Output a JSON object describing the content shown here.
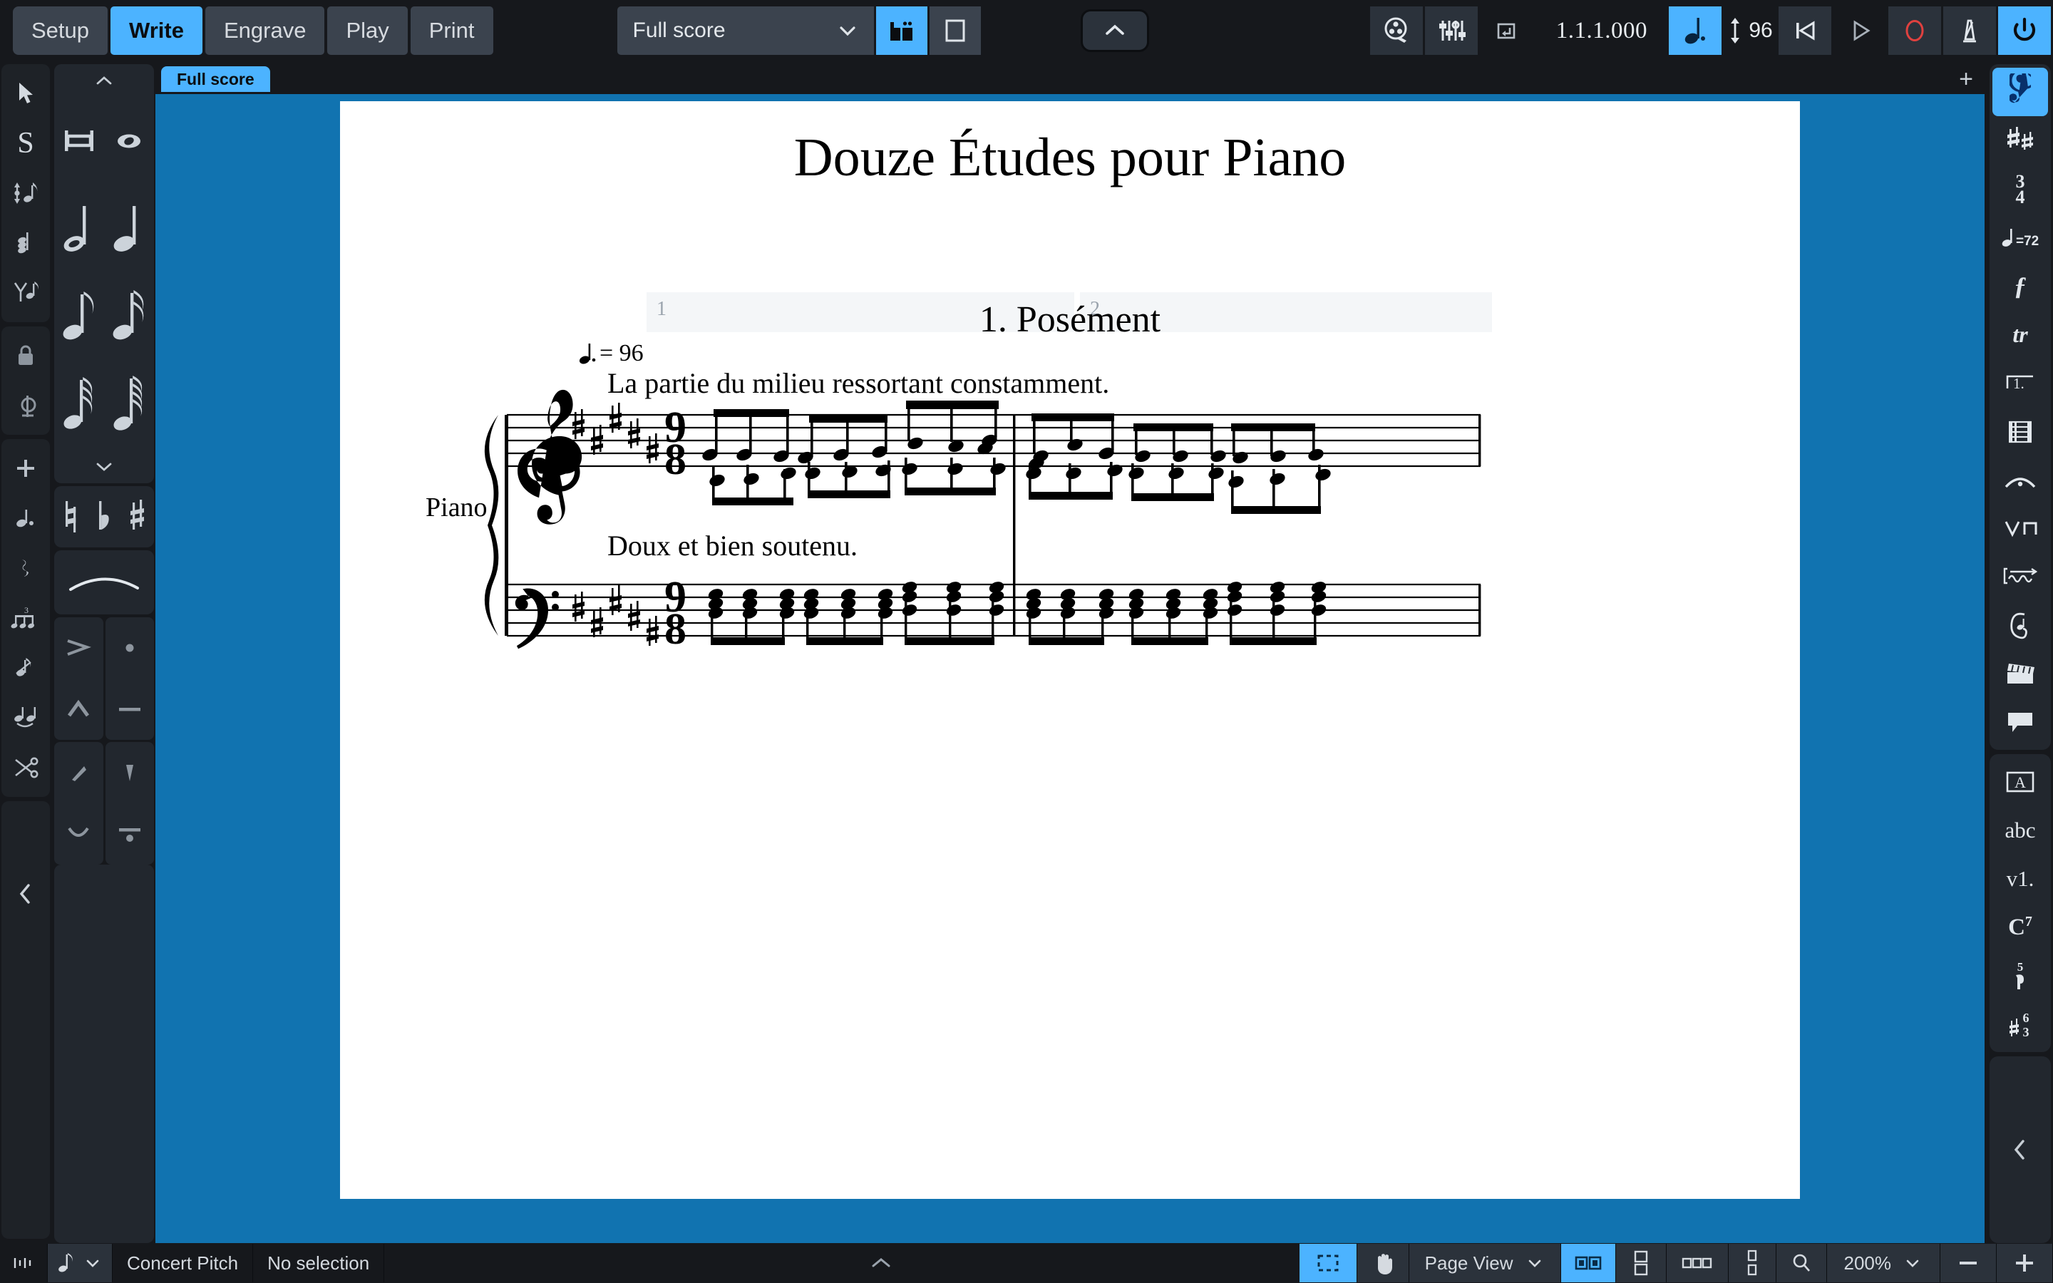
{
  "app": {
    "name": "Dorico",
    "accent": "#4cb3ff",
    "panel_bg": "#22272e",
    "score_bg": "#1173b0"
  },
  "toolbar": {
    "modes": [
      {
        "label": "Setup",
        "active": false,
        "name": "mode-setup"
      },
      {
        "label": "Write",
        "active": true,
        "name": "mode-write"
      },
      {
        "label": "Engrave",
        "active": false,
        "name": "mode-engrave"
      },
      {
        "label": "Play",
        "active": false,
        "name": "mode-play"
      },
      {
        "label": "Print",
        "active": false,
        "name": "mode-print"
      }
    ],
    "layout_select": {
      "value": "Full score",
      "chevron": "chevron-down-icon"
    },
    "view_buttons": [
      {
        "icon": "galley-view-icon",
        "active": true
      },
      {
        "icon": "page-view-icon",
        "active": false
      }
    ],
    "collapse_toolbar": "chevron-up-icon",
    "right_tools": [
      {
        "icon": "video-reel-icon",
        "active": false
      },
      {
        "icon": "mixer-icon",
        "active": false
      },
      {
        "icon": "transport-window-icon",
        "active": false
      }
    ],
    "position_readout": "1.1.1.000",
    "tempo_note_icon": "dotted-quarter-note-icon",
    "tempo_note_active": true,
    "tempo_value": "96",
    "tempo_arrows_icon": "up-down-arrow-icon",
    "transport": [
      {
        "icon": "rewind-to-start-icon",
        "active": false
      },
      {
        "icon": "play-icon",
        "active": false
      },
      {
        "icon": "record-icon",
        "active": false,
        "color": "#e0413f"
      },
      {
        "icon": "metronome-icon",
        "active": false
      },
      {
        "icon": "power-icon",
        "active": true
      }
    ]
  },
  "left_rail": {
    "groups": [
      {
        "items": [
          {
            "icon": "arrow-select-icon",
            "label": "Select tool"
          },
          {
            "icon": "s-slash-icon",
            "label": "Note input"
          },
          {
            "icon": "pitch-before-duration-icon",
            "label": "Pitch before duration"
          },
          {
            "icon": "chord-mode-icon",
            "label": "Chord mode"
          },
          {
            "icon": "voice-icon",
            "label": "Voice"
          }
        ]
      },
      {
        "items": [
          {
            "icon": "lock-duration-icon",
            "label": "Lock duration"
          },
          {
            "icon": "lock-pitch-icon",
            "label": "Lock pitch"
          }
        ]
      },
      {
        "items": [
          {
            "icon": "plus-icon",
            "label": "Insert"
          },
          {
            "icon": "dotted-note-icon",
            "label": "Rhythmic dot"
          },
          {
            "icon": "rest-icon",
            "label": "Rest"
          },
          {
            "icon": "tuplet-icon",
            "label": "Tuplet"
          },
          {
            "icon": "grace-note-icon",
            "label": "Grace note"
          },
          {
            "icon": "tie-icon",
            "label": "Tie"
          },
          {
            "icon": "scissors-icon",
            "label": "Cut"
          }
        ]
      }
    ],
    "collapse": "chevron-left-icon"
  },
  "notes_panel": {
    "scroll_up": "chevron-up-icon",
    "scroll_down": "chevron-down-icon",
    "durations": [
      {
        "icon": "breve-icon",
        "label": "Breve"
      },
      {
        "icon": "whole-note-icon",
        "label": "Whole note"
      },
      {
        "icon": "half-note-icon",
        "label": "Half note"
      },
      {
        "icon": "quarter-note-icon",
        "label": "Quarter note"
      },
      {
        "icon": "eighth-note-icon",
        "label": "Eighth note"
      },
      {
        "icon": "sixteenth-note-icon",
        "label": "16th note"
      },
      {
        "icon": "thirtysecond-note-icon",
        "label": "32nd note"
      },
      {
        "icon": "sixtyfourth-note-icon",
        "label": "64th note"
      }
    ],
    "accidentals": [
      {
        "icon": "natural-icon",
        "label": "Natural"
      },
      {
        "icon": "flat-icon",
        "label": "Flat"
      },
      {
        "icon": "sharp-icon",
        "label": "Sharp"
      }
    ],
    "slur": {
      "icon": "slur-icon",
      "label": "Slur"
    },
    "articulations": [
      {
        "icon": "accent-icon",
        "label": "Accent"
      },
      {
        "icon": "staccato-icon",
        "label": "Staccato"
      },
      {
        "icon": "marcato-icon",
        "label": "Marcato"
      },
      {
        "icon": "tenuto-icon",
        "label": "Tenuto"
      },
      {
        "icon": "stress-icon",
        "label": "Stress"
      },
      {
        "icon": "staccatissimo-icon",
        "label": "Staccatissimo"
      },
      {
        "icon": "unstress-icon",
        "label": "Unstress"
      },
      {
        "icon": "staccato-tenuto-icon",
        "label": "Staccato tenuto"
      }
    ]
  },
  "score": {
    "tab_label": "Full score",
    "add_tab": "plus-icon",
    "title": "Douze Études pour Piano",
    "movement_title": "1. Posément",
    "tempo_text": "= 96",
    "tempo_note": "dotted-quarter-note-icon",
    "instruction_top": "La partie du milieu ressortant constamment.",
    "instruction_bottom": "Doux et bien soutenu.",
    "staff_label": "Piano",
    "bar_numbers": [
      "1",
      "2"
    ],
    "key_signature": "5 sharps",
    "time_signature": "9/8",
    "clefs": [
      "treble",
      "bass"
    ]
  },
  "right_rail": {
    "groups": [
      {
        "items": [
          {
            "icon": "treble-clef-icon",
            "glyph": "𝄞",
            "active": true,
            "label": "Clefs"
          },
          {
            "icon": "key-signature-icon",
            "glyph": "",
            "active": false,
            "label": "Key signatures"
          },
          {
            "icon": "time-signature-icon",
            "glyph": "",
            "active": false,
            "label": "Time signatures"
          },
          {
            "icon": "tempo-icon",
            "glyph": "",
            "active": false,
            "label": "Tempo"
          },
          {
            "icon": "dynamics-icon",
            "glyph": "ƒ",
            "active": false,
            "label": "Dynamics"
          },
          {
            "icon": "ornaments-icon",
            "glyph": "tr",
            "active": false,
            "label": "Ornaments"
          },
          {
            "icon": "repeat-endings-icon",
            "glyph": "1.",
            "active": false,
            "label": "Repeat structures"
          },
          {
            "icon": "barlines-icon",
            "glyph": "",
            "active": false,
            "label": "Barlines"
          },
          {
            "icon": "holds-pauses-icon",
            "glyph": "",
            "active": false,
            "label": "Holds and pauses"
          },
          {
            "icon": "bowing-icon",
            "glyph": "",
            "active": false,
            "label": "Playing techniques"
          },
          {
            "icon": "lines-icon",
            "glyph": "",
            "active": false,
            "label": "Lines"
          },
          {
            "icon": "playback-icon",
            "glyph": "",
            "active": false,
            "label": "Playing techniques"
          },
          {
            "icon": "video-clapper-icon",
            "glyph": "",
            "active": false,
            "label": "Video markers"
          },
          {
            "icon": "comment-icon",
            "glyph": "",
            "active": false,
            "label": "Comments"
          }
        ]
      },
      {
        "items": [
          {
            "icon": "text-frame-icon",
            "glyph": "A",
            "active": false,
            "label": "Text"
          },
          {
            "icon": "lyrics-icon",
            "glyph": "abc",
            "active": false,
            "label": "Lyrics"
          },
          {
            "icon": "chord-diagram-icon",
            "glyph": "v1.",
            "active": false,
            "label": "Fretboard"
          },
          {
            "icon": "chord-symbol-icon",
            "glyph": "C7",
            "active": false,
            "label": "Chord symbols"
          },
          {
            "icon": "fingering-icon",
            "glyph": "5",
            "active": false,
            "label": "Fingering"
          },
          {
            "icon": "figured-bass-icon",
            "glyph": "63",
            "active": false,
            "label": "Figured bass"
          }
        ]
      }
    ],
    "collapse": "chevron-left-icon"
  },
  "statusbar": {
    "left_icon": "rhythmic-grid-icon",
    "grid_note": {
      "icon": "eighth-note-icon",
      "chevron": "chevron-down-icon"
    },
    "concert_pitch": "Concert Pitch",
    "selection": "No selection",
    "center_collapse": "chevron-up-icon",
    "marquee_tool": {
      "icon": "marquee-select-icon",
      "active": true
    },
    "hand_tool": {
      "icon": "hand-tool-icon",
      "active": false
    },
    "view_mode": {
      "value": "Page View",
      "chevron": "chevron-down-icon"
    },
    "page_arrangements": [
      {
        "icon": "spreads-icon",
        "active": true
      },
      {
        "icon": "two-up-icon",
        "active": false
      },
      {
        "icon": "three-up-icon",
        "active": false
      },
      {
        "icon": "vertical-pages-icon",
        "active": false
      }
    ],
    "zoom_icon": "magnifier-icon",
    "zoom_value": "200%",
    "zoom_chevron": "chevron-down-icon",
    "zoom_out": "minus-icon",
    "zoom_in": "plus-icon"
  },
  "chart_data": null
}
